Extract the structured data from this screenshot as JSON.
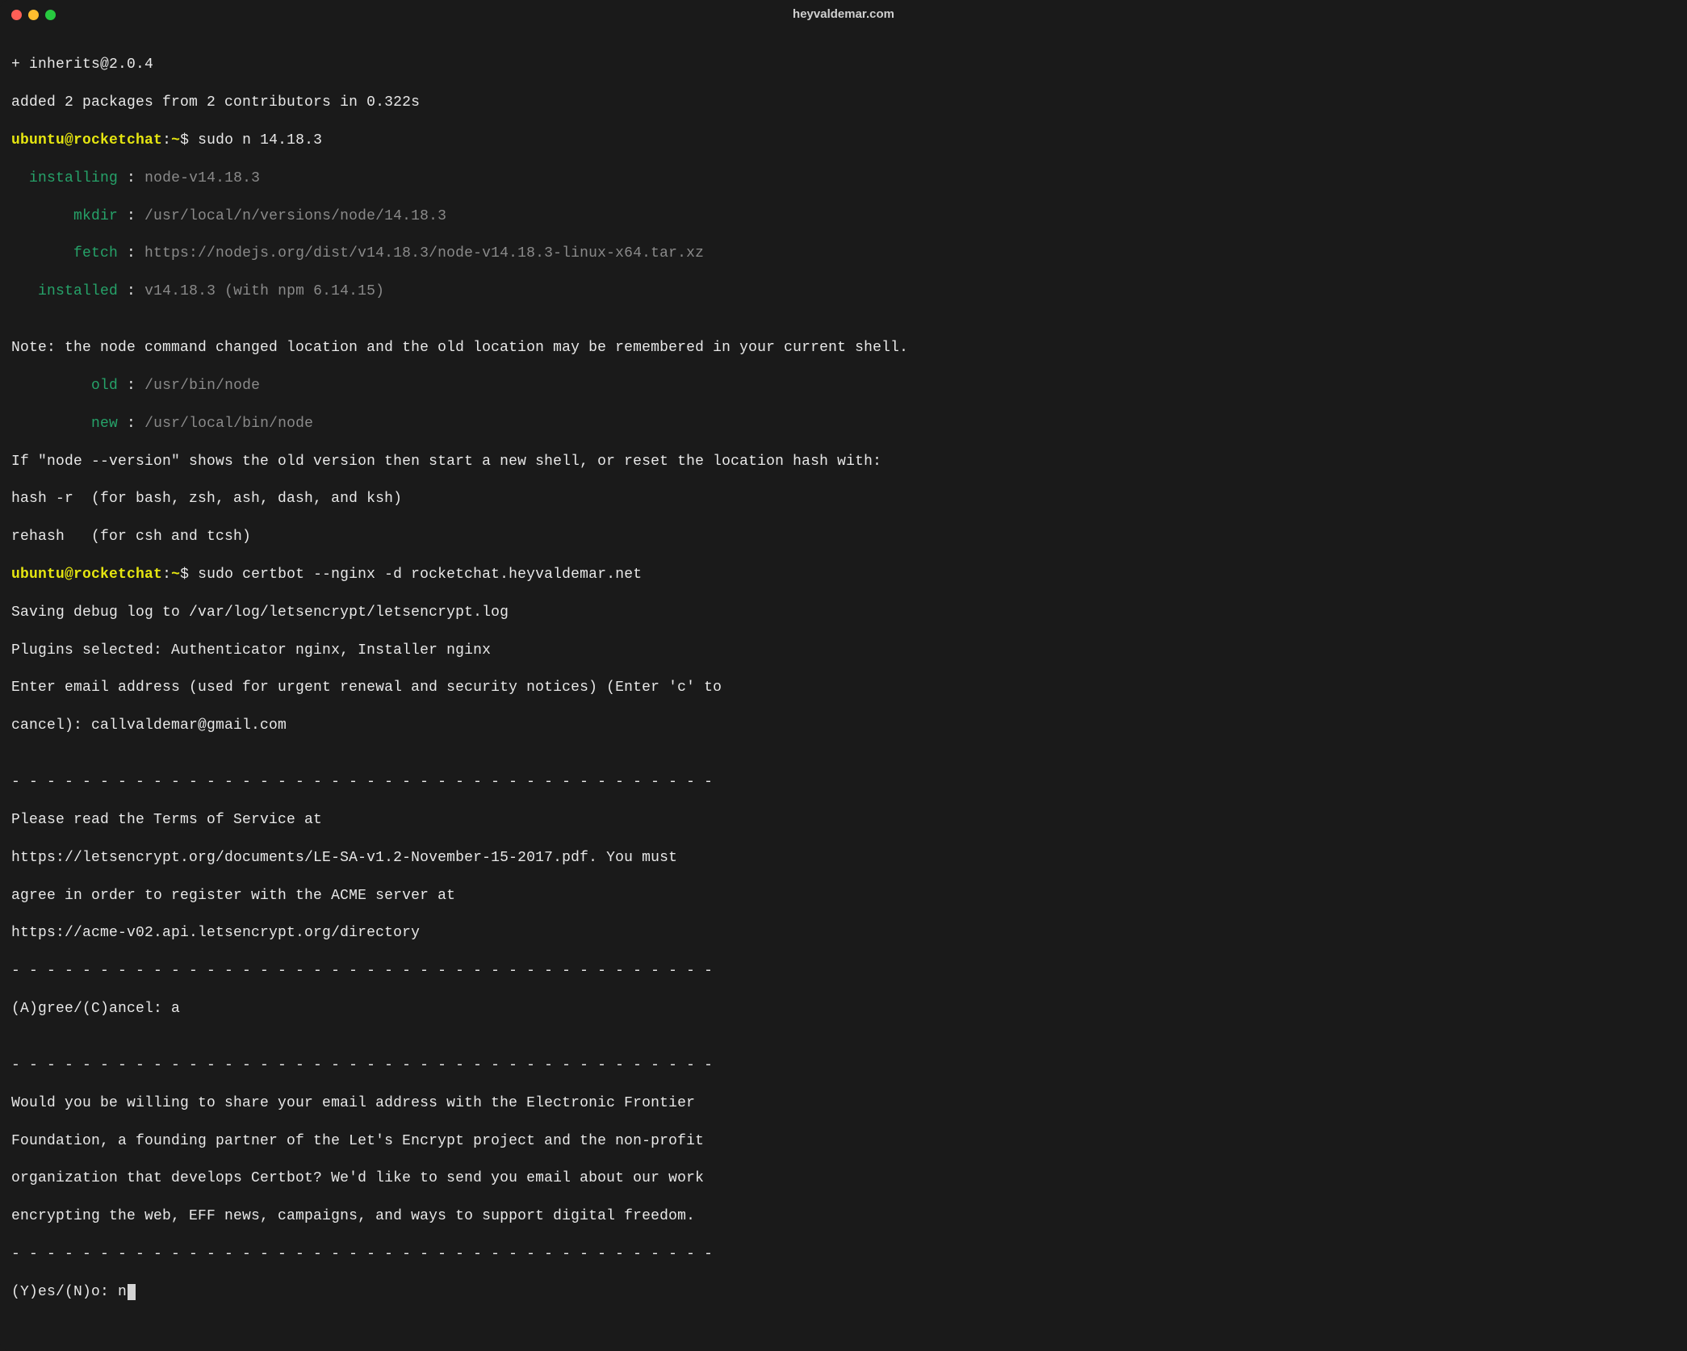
{
  "window": {
    "title": "heyvaldemar.com"
  },
  "prompt": {
    "user": "ubuntu",
    "at": "@",
    "host": "rocketchat",
    "colon": ":",
    "path": "~",
    "dollar": "$ "
  },
  "lines": {
    "l1": "+ inherits@2.0.4",
    "l2": "added 2 packages from 2 contributors in 0.322s",
    "cmd1": "sudo n 14.18.3",
    "inst_lbl_installing": "  installing",
    "inst_sep_installing": " : ",
    "inst_val_installing": "node-v14.18.3",
    "inst_lbl_mkdir": "       mkdir",
    "inst_sep_mkdir": " : ",
    "inst_val_mkdir": "/usr/local/n/versions/node/14.18.3",
    "inst_lbl_fetch": "       fetch",
    "inst_sep_fetch": " : ",
    "inst_val_fetch": "https://nodejs.org/dist/v14.18.3/node-v14.18.3-linux-x64.tar.xz",
    "inst_lbl_installed": "   installed",
    "inst_sep_installed": " : ",
    "inst_val_installed": "v14.18.3 (with npm 6.14.15)",
    "blank": "",
    "note1": "Note: the node command changed location and the old location may be remembered in your current shell.",
    "old_lbl": "         old",
    "old_sep": " : ",
    "old_val": "/usr/bin/node",
    "new_lbl": "         new",
    "new_sep": " : ",
    "new_val": "/usr/local/bin/node",
    "note2": "If \"node --version\" shows the old version then start a new shell, or reset the location hash with:",
    "note3": "hash -r  (for bash, zsh, ash, dash, and ksh)",
    "note4": "rehash   (for csh and tcsh)",
    "cmd2": "sudo certbot --nginx -d rocketchat.heyvaldemar.net",
    "cb1": "Saving debug log to /var/log/letsencrypt/letsencrypt.log",
    "cb2": "Plugins selected: Authenticator nginx, Installer nginx",
    "cb3": "Enter email address (used for urgent renewal and security notices) (Enter 'c' to",
    "cb4": "cancel): callvaldemar@gmail.com",
    "dashes": "- - - - - - - - - - - - - - - - - - - - - - - - - - - - - - - - - - - - - - - -",
    "tos1": "Please read the Terms of Service at",
    "tos2": "https://letsencrypt.org/documents/LE-SA-v1.2-November-15-2017.pdf. You must",
    "tos3": "agree in order to register with the ACME server at",
    "tos4": "https://acme-v02.api.letsencrypt.org/directory",
    "agree": "(A)gree/(C)ancel: a",
    "eff1": "Would you be willing to share your email address with the Electronic Frontier",
    "eff2": "Foundation, a founding partner of the Let's Encrypt project and the non-profit",
    "eff3": "organization that develops Certbot? We'd like to send you email about our work",
    "eff4": "encrypting the web, EFF news, campaigns, and ways to support digital freedom.",
    "yesno": "(Y)es/(N)o: n"
  }
}
